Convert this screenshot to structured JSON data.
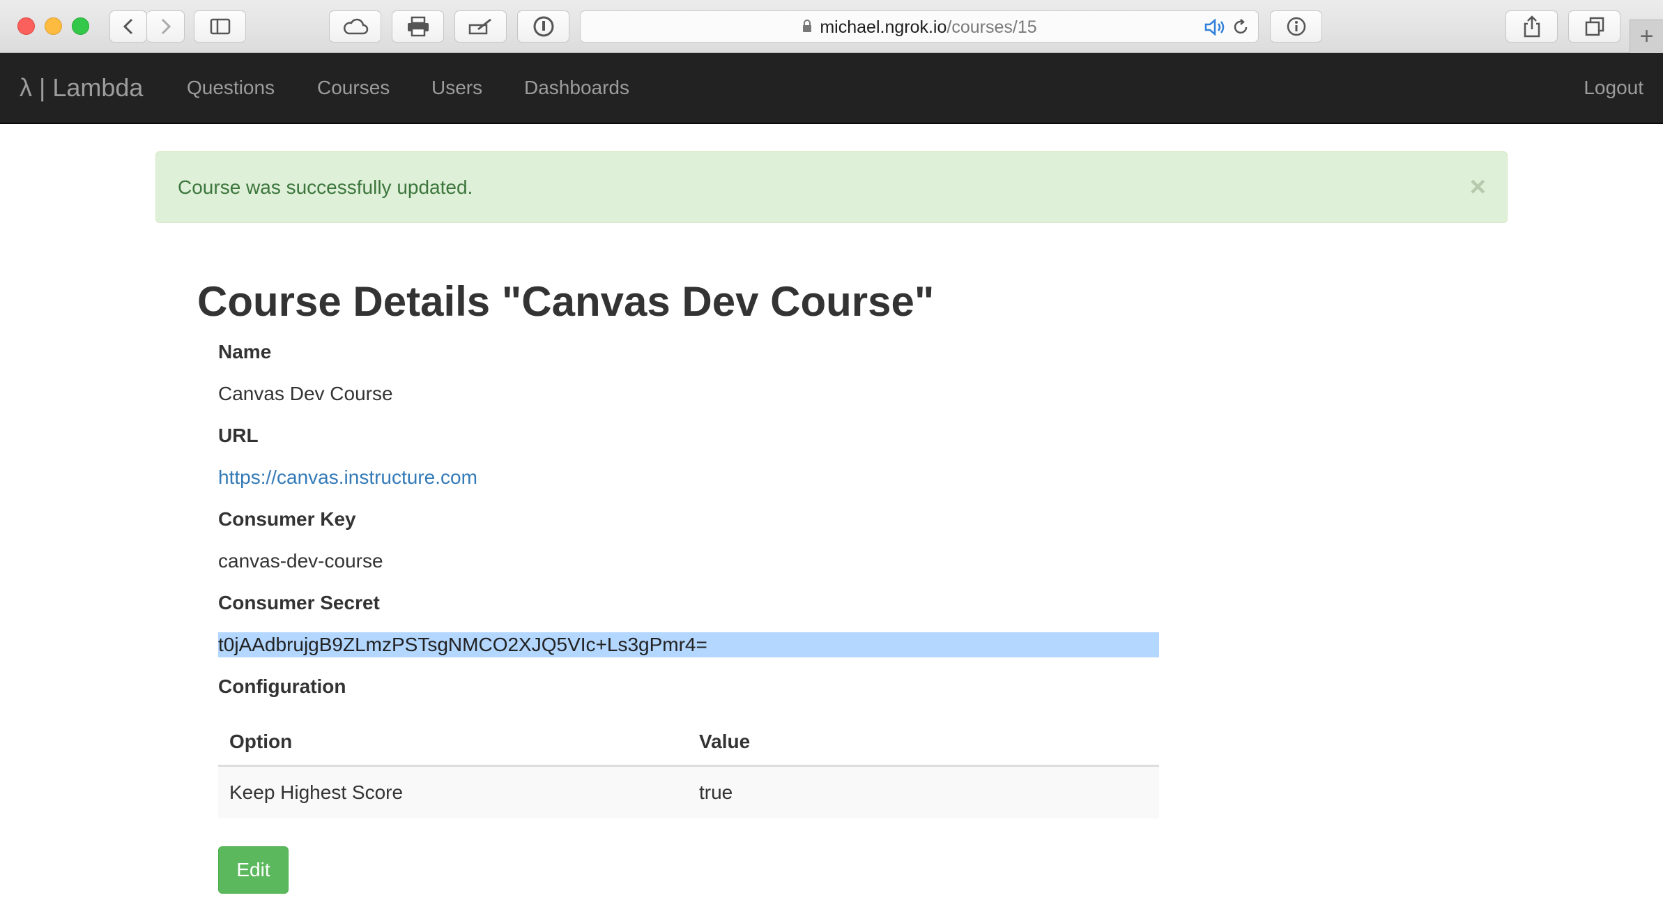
{
  "browser": {
    "url_host": "michael.ngrok.io",
    "url_path": "/courses/15",
    "icons": [
      "back-icon",
      "forward-icon",
      "sidebar-icon",
      "cloud-icon",
      "print-icon",
      "edit-icon",
      "password-icon",
      "lock-icon",
      "audio-icon",
      "reload-icon",
      "info-icon",
      "share-icon",
      "tabs-icon",
      "new-tab-icon"
    ],
    "new_tab_glyph": "+"
  },
  "navbar": {
    "brand": "λ | Lambda",
    "links": [
      "Questions",
      "Courses",
      "Users",
      "Dashboards"
    ],
    "logout": "Logout",
    "background": "#222222",
    "link_color": "#9d9d9d"
  },
  "alert": {
    "message": "Course was successfully updated.",
    "close": "×",
    "background": "#dff0d8",
    "text_color": "#3c763d"
  },
  "page": {
    "title": "Course Details \"Canvas Dev Course\""
  },
  "details": {
    "name_label": "Name",
    "name_value": "Canvas Dev Course",
    "url_label": "URL",
    "url_value": "https://canvas.instructure.com",
    "key_label": "Consumer Key",
    "key_value": "canvas-dev-course",
    "secret_label": "Consumer Secret",
    "secret_value": "t0jAAdbrujgB9ZLmzPSTsgNMCO2XJQ5VIc+Ls3gPmr4=",
    "config_label": "Configuration"
  },
  "config_table": {
    "headers": [
      "Option",
      "Value"
    ],
    "rows": [
      [
        "Keep Highest Score",
        "true"
      ]
    ]
  },
  "actions": {
    "edit": "Edit",
    "edit_color": "#5cb85c"
  }
}
